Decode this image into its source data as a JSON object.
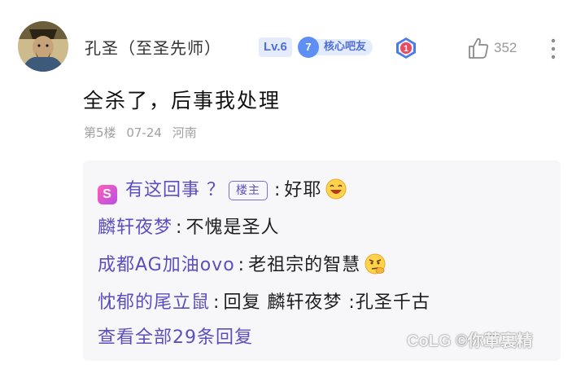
{
  "post": {
    "username": "孔圣（至圣先师）",
    "level": "Lv.6",
    "fan_level": "7",
    "fan_badge": "核心吧友",
    "rank": "1",
    "likes": "352",
    "content": "全杀了，后事我处理",
    "floor": "第5楼",
    "date": "07-24",
    "location": "河南"
  },
  "replies": [
    {
      "author": "有这回事 ？",
      "badge": "楼主",
      "text": "好耶",
      "emoji": "laughing-emoji"
    },
    {
      "author": "麟轩夜梦",
      "text": "不愧是圣人"
    },
    {
      "author": "成都AG加油ovo",
      "text": "老祖宗的智慧",
      "emoji": "thinking-emoji"
    },
    {
      "author": "忱郁的尾立鼠",
      "text": "回复 麟轩夜梦 :孔圣千古"
    }
  ],
  "view_all": "查看全部29条回复",
  "watermark": "CoLG ©你莗裏精",
  "colors": {
    "accent": "#5b4fbf",
    "level_badge_bg": "#e4ebfd",
    "fan_badge": "#5d8ff5",
    "reply_box_bg": "#f7f7f9"
  }
}
